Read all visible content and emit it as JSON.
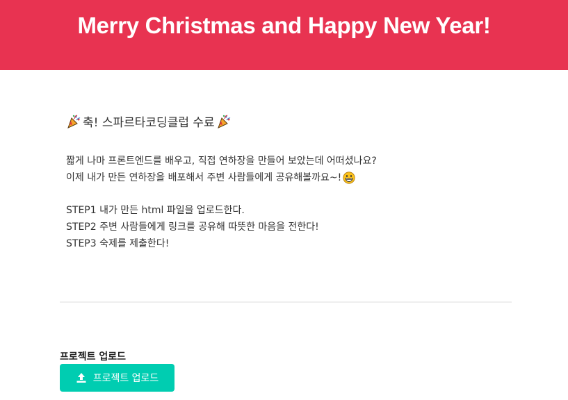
{
  "header": {
    "title": "Merry Christmas and Happy New Year!"
  },
  "main": {
    "congrats": "축! 스파르타코딩클럽 수료",
    "intro_lines": [
      "짧게 나마 프론트엔드를 배우고, 직접 연하장을 만들어 보았는데 어떠셨나요?",
      "이제 내가 만든 연하장을 배포해서 주변 사람들에게 공유해볼까요~!"
    ],
    "steps": [
      "STEP1 내가 만든 html 파일을 업로드한다.",
      "STEP2 주변 사람들에게 링크를 공유해 따뜻한 마음을 전한다!",
      "STEP3 숙제를 제출한다!"
    ]
  },
  "upload": {
    "label": "프로젝트 업로드",
    "button_label": "프로젝트 업로드",
    "button_icon": "upload-icon"
  },
  "icons": {
    "party": "party-popper-icon",
    "grin": "grinning-face-icon"
  },
  "colors": {
    "header_bg": "#e83351",
    "button_bg": "#00cdb1",
    "text": "#333333"
  }
}
